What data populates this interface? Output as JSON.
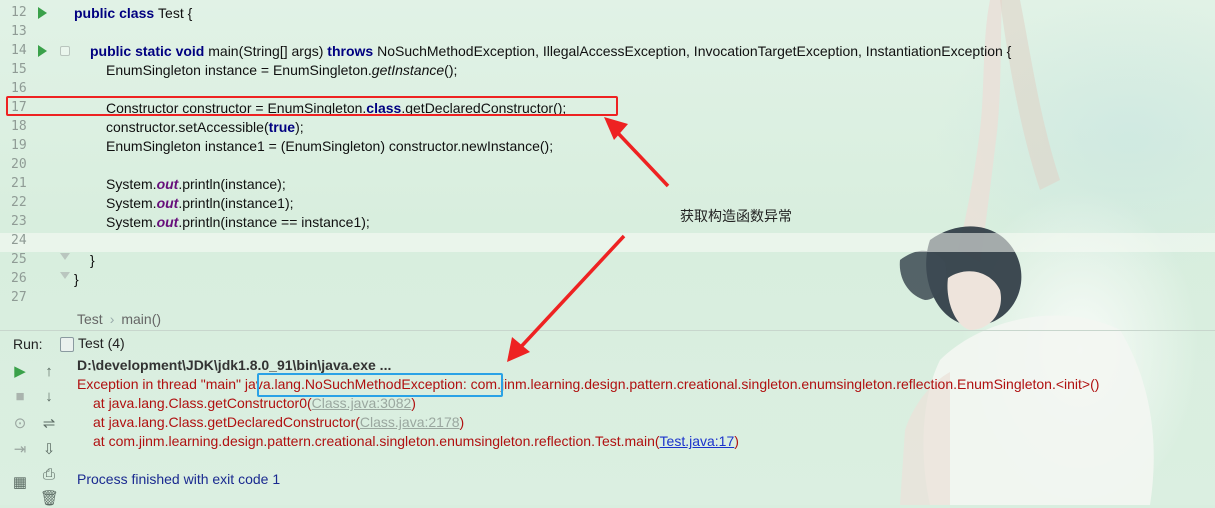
{
  "editor": {
    "lines": [
      {
        "n": "12",
        "run": true,
        "fold": "",
        "indent": 0,
        "parts": [
          [
            "kw",
            "public class "
          ],
          [
            "",
            "Test {"
          ]
        ]
      },
      {
        "n": "13",
        "run": false,
        "fold": "",
        "indent": 0,
        "parts": []
      },
      {
        "n": "14",
        "run": true,
        "fold": "start",
        "indent": 1,
        "parts": [
          [
            "kw",
            "public static void "
          ],
          [
            "",
            "main(String[] args) "
          ],
          [
            "kw",
            "throws "
          ],
          [
            "",
            "NoSuchMethodException, IllegalAccessException, InvocationTargetException, InstantiationException {"
          ]
        ]
      },
      {
        "n": "15",
        "run": false,
        "fold": "",
        "indent": 2,
        "parts": [
          [
            "",
            "EnumSingleton instance = EnumSingleton."
          ],
          [
            "it",
            "getInstance"
          ],
          [
            "",
            "();"
          ]
        ]
      },
      {
        "n": "16",
        "run": false,
        "fold": "",
        "indent": 0,
        "parts": []
      },
      {
        "n": "17",
        "run": false,
        "fold": "",
        "indent": 2,
        "parts": [
          [
            "",
            "Constructor constructor = EnumSingleton."
          ],
          [
            "kw",
            "class"
          ],
          [
            "",
            ".getDeclaredConstructor();"
          ]
        ]
      },
      {
        "n": "18",
        "run": false,
        "fold": "",
        "indent": 2,
        "parts": [
          [
            "",
            "constructor.setAccessible("
          ],
          [
            "kw",
            "true"
          ],
          [
            "",
            ");"
          ]
        ]
      },
      {
        "n": "19",
        "run": false,
        "fold": "",
        "indent": 2,
        "parts": [
          [
            "",
            "EnumSingleton instance1 = (EnumSingleton) constructor.newInstance();"
          ]
        ]
      },
      {
        "n": "20",
        "run": false,
        "fold": "",
        "indent": 0,
        "parts": []
      },
      {
        "n": "21",
        "run": false,
        "fold": "",
        "indent": 2,
        "parts": [
          [
            "",
            "System."
          ],
          [
            "st",
            "out"
          ],
          [
            "",
            ".println(instance);"
          ]
        ]
      },
      {
        "n": "22",
        "run": false,
        "fold": "",
        "indent": 2,
        "parts": [
          [
            "",
            "System."
          ],
          [
            "st",
            "out"
          ],
          [
            "",
            ".println(instance1);"
          ]
        ]
      },
      {
        "n": "23",
        "run": false,
        "fold": "",
        "indent": 2,
        "parts": [
          [
            "",
            "System."
          ],
          [
            "st",
            "out"
          ],
          [
            "",
            ".println(instance == instance1);"
          ]
        ]
      },
      {
        "n": "24",
        "run": false,
        "fold": "",
        "indent": 0,
        "parts": []
      },
      {
        "n": "25",
        "run": false,
        "fold": "end",
        "indent": 1,
        "parts": [
          [
            "",
            "}"
          ]
        ]
      },
      {
        "n": "26",
        "run": false,
        "fold": "end",
        "indent": 0,
        "parts": [
          [
            "",
            "}"
          ]
        ]
      },
      {
        "n": "27",
        "run": false,
        "fold": "",
        "indent": 0,
        "parts": []
      }
    ]
  },
  "annotation": "获取构造函数异常",
  "breadcrumb": {
    "class_name": "Test",
    "separator": "›",
    "method": "main()"
  },
  "run_panel": {
    "label": "Run:",
    "tab_name": "Test (4)",
    "console": {
      "cmd": "D:\\development\\JDK\\jdk1.8.0_91\\bin\\java.exe ...",
      "exception_prefix": "Exception in thread \"main\" ",
      "exception_type": "java.lang.NoSuchMethodException:",
      "exception_rest": " com.jinm.learning.design.pattern.creational.singleton.enumsingleton.reflection.EnumSingleton.<init>()",
      "trace": [
        {
          "text": "at java.lang.Class.getConstructor0(",
          "link": "Class.java:3082",
          "link_style": "grey",
          "end": ")"
        },
        {
          "text": "at java.lang.Class.getDeclaredConstructor(",
          "link": "Class.java:2178",
          "link_style": "grey",
          "end": ")"
        },
        {
          "text": "at com.jinm.learning.design.pattern.creational.singleton.enumsingleton.reflection.Test.main(",
          "link": "Test.java:17",
          "link_style": "blue",
          "end": ")"
        }
      ],
      "exit": "Process finished with exit code 1"
    },
    "toolbar_left": [
      "run-icon",
      "stop-icon",
      "camera-icon",
      "login-icon",
      "layout-icon"
    ],
    "toolbar_right": [
      "up-arrow-icon",
      "down-arrow-icon",
      "soft-wrap-icon",
      "scroll-to-end-icon",
      "print-icon",
      "trash-icon"
    ]
  },
  "colors": {
    "keyword": "#000080",
    "static_field": "#660e7a",
    "error": "#b01010",
    "highlight_red": "#ee2222",
    "highlight_blue": "#2aa2e6",
    "run_green": "#3aa14a"
  }
}
